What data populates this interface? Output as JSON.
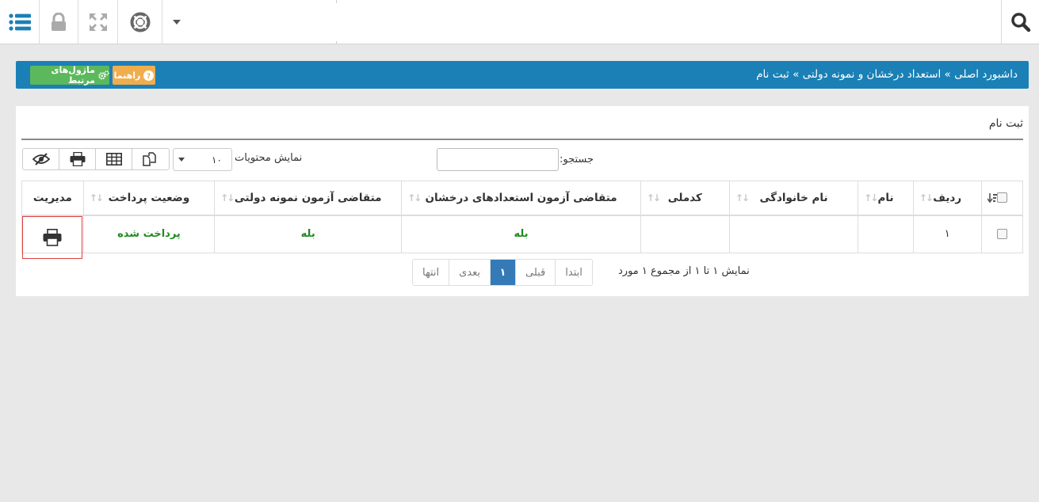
{
  "topbar": {
    "icons": [
      "list-icon",
      "lock-icon",
      "expand-icon",
      "lifebuoy-icon",
      "caret-down-icon",
      "search-icon"
    ]
  },
  "breadcrumb": {
    "text": "داشبورد اصلی » استعداد درخشان و نمونه دولتی » ثبت نام",
    "help_label": "راهنما",
    "modules_label": "ماژول‌های مرتبط"
  },
  "panel": {
    "title": "ثبت نام",
    "search_label": "جستجو:",
    "show_label": "نمایش محتویات",
    "length_value": "۱۰"
  },
  "table": {
    "headers": [
      "ردیف",
      "نام",
      "نام خانوادگی",
      "کدملی",
      "متقاضی آزمون استعدادهای درخشان",
      "متقاضی آزمون نمونه دولتی",
      "وضعیت پرداخت",
      "مدیریت"
    ],
    "rows": [
      {
        "row_num": "۱",
        "first_name": "",
        "last_name": "",
        "national_code": "",
        "talent_applicant": "بله",
        "gov_applicant": "بله",
        "payment_status": "پرداخت شده"
      }
    ]
  },
  "pagination": {
    "info": "نمایش ۱ تا ۱ از مجموع ۱ مورد",
    "first": "ابتدا",
    "prev": "قبلی",
    "current": "۱",
    "next": "بعدی",
    "last": "انتها"
  },
  "colors": {
    "brand_blue": "#1a80b6",
    "help_orange": "#f0ad4e",
    "modules_green": "#5cb85c",
    "status_green": "#1f8a1f",
    "page_active": "#337ab7"
  }
}
